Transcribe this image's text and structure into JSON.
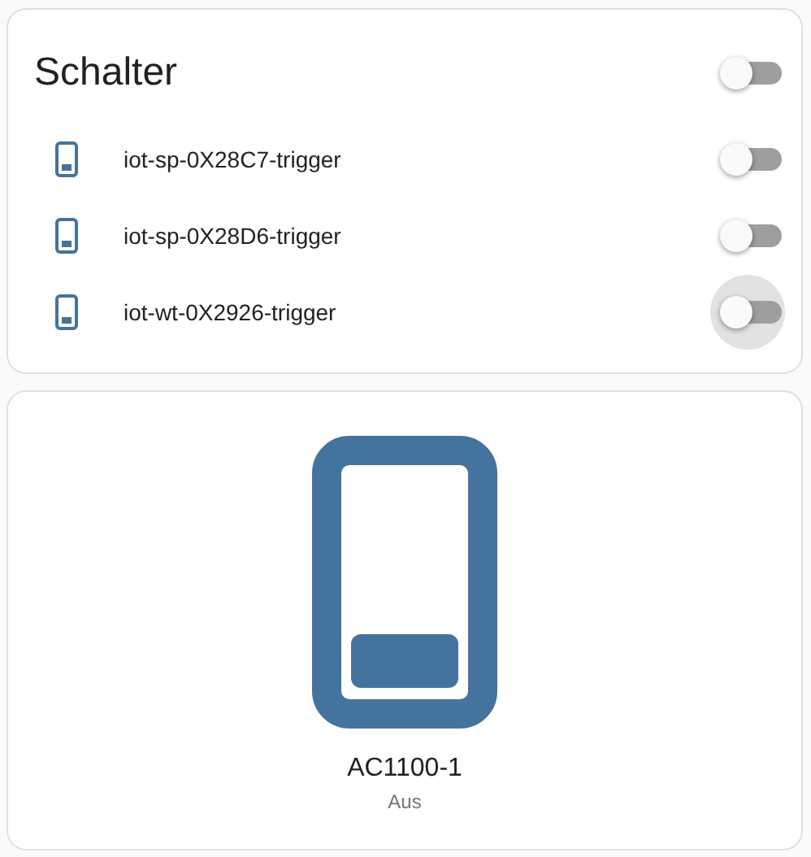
{
  "entities_card": {
    "title": "Schalter",
    "header_toggle": {
      "on": false
    },
    "rows": [
      {
        "name": "iot-sp-0X28C7-trigger",
        "on": false,
        "focused": false
      },
      {
        "name": "iot-sp-0X28D6-trigger",
        "on": false,
        "focused": false
      },
      {
        "name": "iot-wt-0X2926-trigger",
        "on": false,
        "focused": true
      }
    ]
  },
  "button_card": {
    "name": "AC1100-1",
    "state": "Aus",
    "on": false
  }
}
